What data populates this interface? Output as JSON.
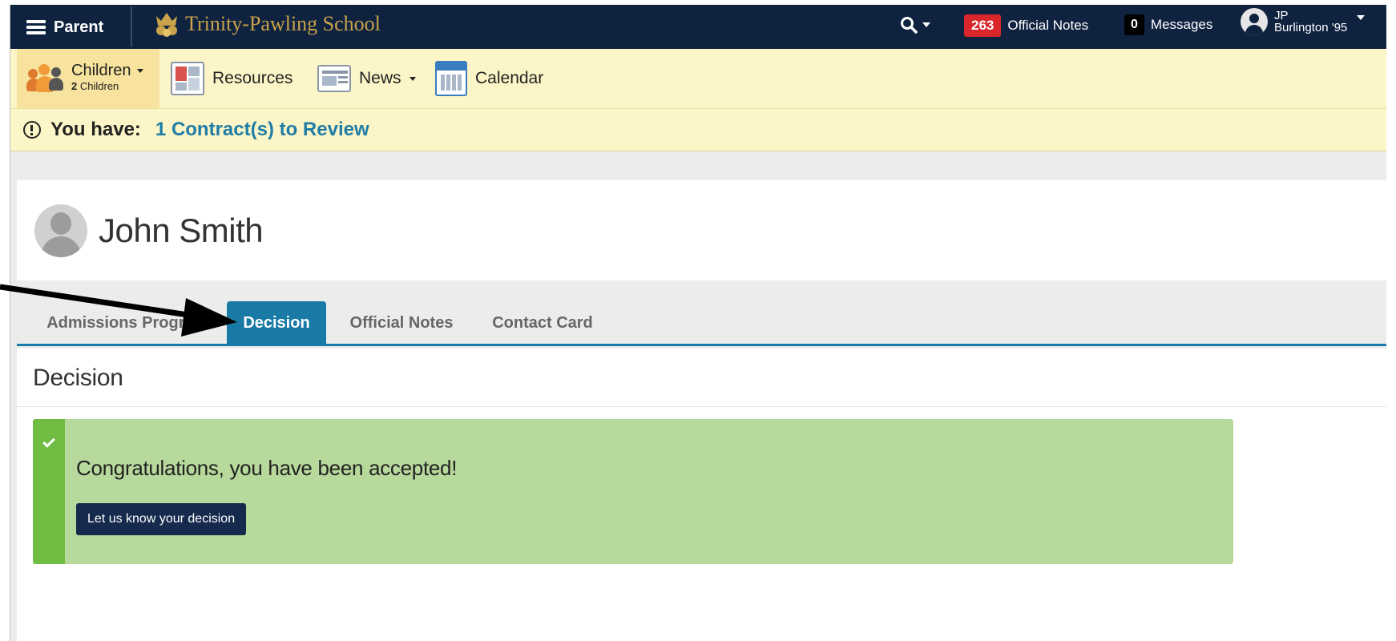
{
  "topnav": {
    "menu_label": "Parent",
    "school_name": "Trinity-Pawling School",
    "official_notes_count": "263",
    "official_notes_label": "Official Notes",
    "messages_count": "0",
    "messages_label": "Messages",
    "user_initials": "JP",
    "user_name": "Burlington '95"
  },
  "subnav": {
    "children_label": "Children",
    "children_count": "2",
    "children_sub": "Children",
    "resources_label": "Resources",
    "news_label": "News",
    "calendar_label": "Calendar"
  },
  "alert": {
    "prefix": "You have:",
    "link": "1 Contract(s) to Review"
  },
  "profile": {
    "name": "John Smith"
  },
  "tabs": [
    {
      "label": "Admissions Progress"
    },
    {
      "label": "Decision"
    },
    {
      "label": "Official Notes"
    },
    {
      "label": "Contact Card"
    }
  ],
  "decision": {
    "title": "Decision",
    "message": "Congratulations, you have been accepted!",
    "button_label": "Let us know your decision"
  },
  "colors": {
    "navbar": "#0f2340",
    "subnav": "#fcf5c7",
    "accent": "#1a7aa6",
    "success": "#b7d99c",
    "success_stripe": "#71bd44",
    "badge_red": "#d9262a"
  }
}
